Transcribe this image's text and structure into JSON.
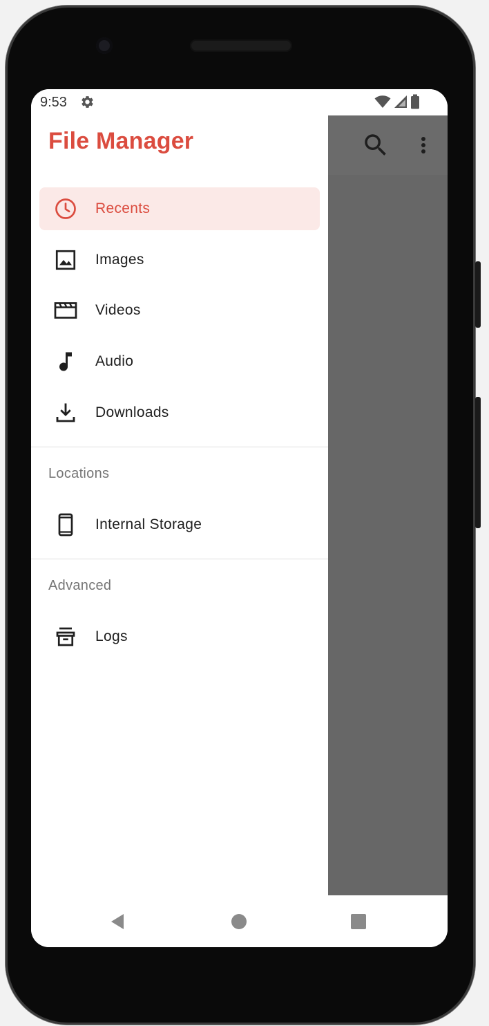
{
  "status_bar": {
    "time": "9:53",
    "icons": [
      "settings-gear-icon",
      "wifi-icon",
      "cell-signal-icon",
      "battery-icon"
    ]
  },
  "drawer": {
    "title": "File Manager",
    "accent_color": "#db4c3f",
    "active_background": "#fbe9e7",
    "items": [
      {
        "label": "Recents",
        "icon": "clock-icon",
        "active": true
      },
      {
        "label": "Images",
        "icon": "image-icon",
        "active": false
      },
      {
        "label": "Videos",
        "icon": "movie-icon",
        "active": false
      },
      {
        "label": "Audio",
        "icon": "music-note-icon",
        "active": false
      },
      {
        "label": "Downloads",
        "icon": "download-icon",
        "active": false
      }
    ],
    "locations": {
      "header": "Locations",
      "items": [
        {
          "label": "Internal Storage",
          "icon": "phone-icon"
        }
      ]
    },
    "advanced": {
      "header": "Advanced",
      "items": [
        {
          "label": "Logs",
          "icon": "archive-icon"
        }
      ]
    }
  },
  "app_bar": {
    "icons": [
      "search-icon",
      "more-vert-icon"
    ]
  },
  "navigation_bar": {
    "icons": [
      "back-icon",
      "home-icon",
      "recents-square-icon"
    ]
  }
}
